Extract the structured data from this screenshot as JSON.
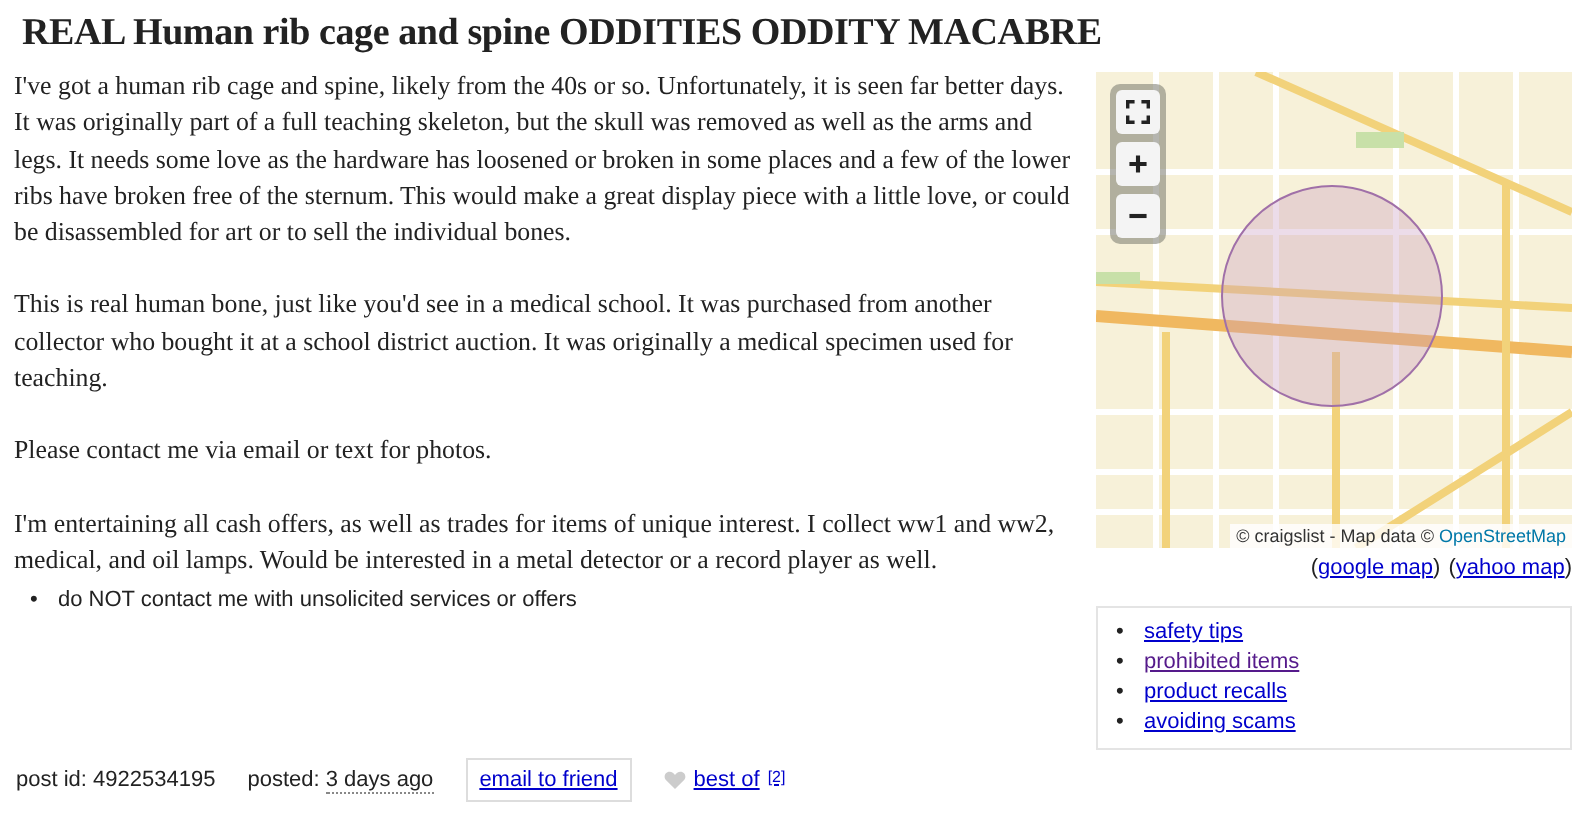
{
  "posting": {
    "title": "REAL Human rib cage and spine ODDITIES ODDITY MACABRE",
    "paragraphs": [
      "I've got a human rib cage and spine, likely from the 40s or so. Unfortunately, it is seen far better days. It was originally part of a full teaching skeleton, but the skull was removed as well as the arms and legs. It needs some love as the hardware has loosened or broken in some places and a few of the lower ribs have broken free of the sternum. This would make a great display piece with a little love, or could be disassembled for art or to sell the individual bones.",
      "This is real human bone, just like you'd see in a medical school. It was purchased from another collector who bought it at a school district auction. It was originally a medical specimen used for teaching.",
      "Please contact me via email or text for photos.",
      "I'm entertaining all cash offers, as well as trades for items of unique interest. I collect ww1 and ww2, medical, and oil lamps. Would be interested in a metal detector or a record player as well."
    ],
    "notices": [
      {
        "bullet": "•",
        "text": "do NOT contact me with unsolicited services or offers"
      }
    ]
  },
  "map": {
    "attribution": "© craigslist - Map data © ",
    "attribution_link": "OpenStreetMap",
    "links": [
      {
        "open": "(",
        "label": "google map",
        "close": ")"
      },
      {
        "open": "(",
        "label": "yahoo map",
        "close": ")"
      }
    ]
  },
  "safety_links": [
    {
      "bullet": "•",
      "label": "safety tips",
      "visited": false
    },
    {
      "bullet": "•",
      "label": "prohibited items",
      "visited": true
    },
    {
      "bullet": "•",
      "label": "product recalls",
      "visited": false
    },
    {
      "bullet": "•",
      "label": "avoiding scams",
      "visited": false
    }
  ],
  "footer": {
    "post_id": "post id: 4922534195",
    "posted_label": "posted:",
    "posted_value": "3 days ago",
    "email_button": "email to friend",
    "best_of": "best of",
    "best_of_count": "[2]"
  }
}
